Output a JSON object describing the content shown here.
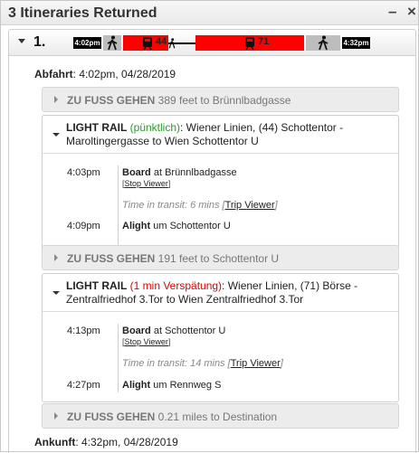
{
  "header": {
    "title": "3 Itineraries Returned",
    "minimize_label": "–",
    "close_label": "×"
  },
  "itinerary": {
    "number": "1.",
    "start_time": "4:02pm",
    "end_time": "4:32pm",
    "segments": [
      {
        "mode": "walk"
      },
      {
        "mode": "rail",
        "route": "44"
      },
      {
        "mode": "walk"
      },
      {
        "mode": "rail",
        "route": "71"
      },
      {
        "mode": "walk"
      }
    ],
    "colors": {
      "rail": "#ff0000",
      "walk": "#bdbdbd"
    }
  },
  "departure": {
    "label": "Abfahrt",
    "value": ": 4:02pm, 04/28/2019"
  },
  "arrival": {
    "label": "Ankunft",
    "value": ": 4:32pm, 04/28/2019"
  },
  "legs": {
    "walk1": {
      "mode": "ZU FUSS GEHEN",
      "detail": " 389 feet to Brünnlbadgasse"
    },
    "rail1": {
      "mode": "LIGHT RAIL",
      "status": " (pünktlich)",
      "line1": ": Wiener Linien, (44) Schottentor -",
      "line2": "Maroltingergasse to Wien Schottentor U",
      "board_time": "4:03pm",
      "board_label": "Board",
      "board_stop": " at Brünnlbadgasse",
      "stop_viewer": "Stop Viewer",
      "transit_text": "Time in transit: 6 mins ",
      "trip_viewer": "Trip Viewer",
      "alight_time": "4:09pm",
      "alight_label": "Alight",
      "alight_stop": " um Schottentor U"
    },
    "walk2": {
      "mode": "ZU FUSS GEHEN",
      "detail": " 191 feet to Schottentor U"
    },
    "rail2": {
      "mode": "LIGHT RAIL",
      "status": " (1 min Verspätung)",
      "line1": ": Wiener Linien, (71) Börse -",
      "line2": "Zentralfriedhof 3.Tor to Wien Zentralfriedhof 3.Tor",
      "board_time": "4:13pm",
      "board_label": "Board",
      "board_stop": " at Schottentor U",
      "stop_viewer": "Stop Viewer",
      "transit_text": "Time in transit: 14 mins ",
      "trip_viewer": "Trip Viewer",
      "alight_time": "4:27pm",
      "alight_label": "Alight",
      "alight_stop": " um Rennweg S"
    },
    "walk3": {
      "mode": "ZU FUSS GEHEN",
      "detail": " 0.21 miles to Destination"
    }
  }
}
